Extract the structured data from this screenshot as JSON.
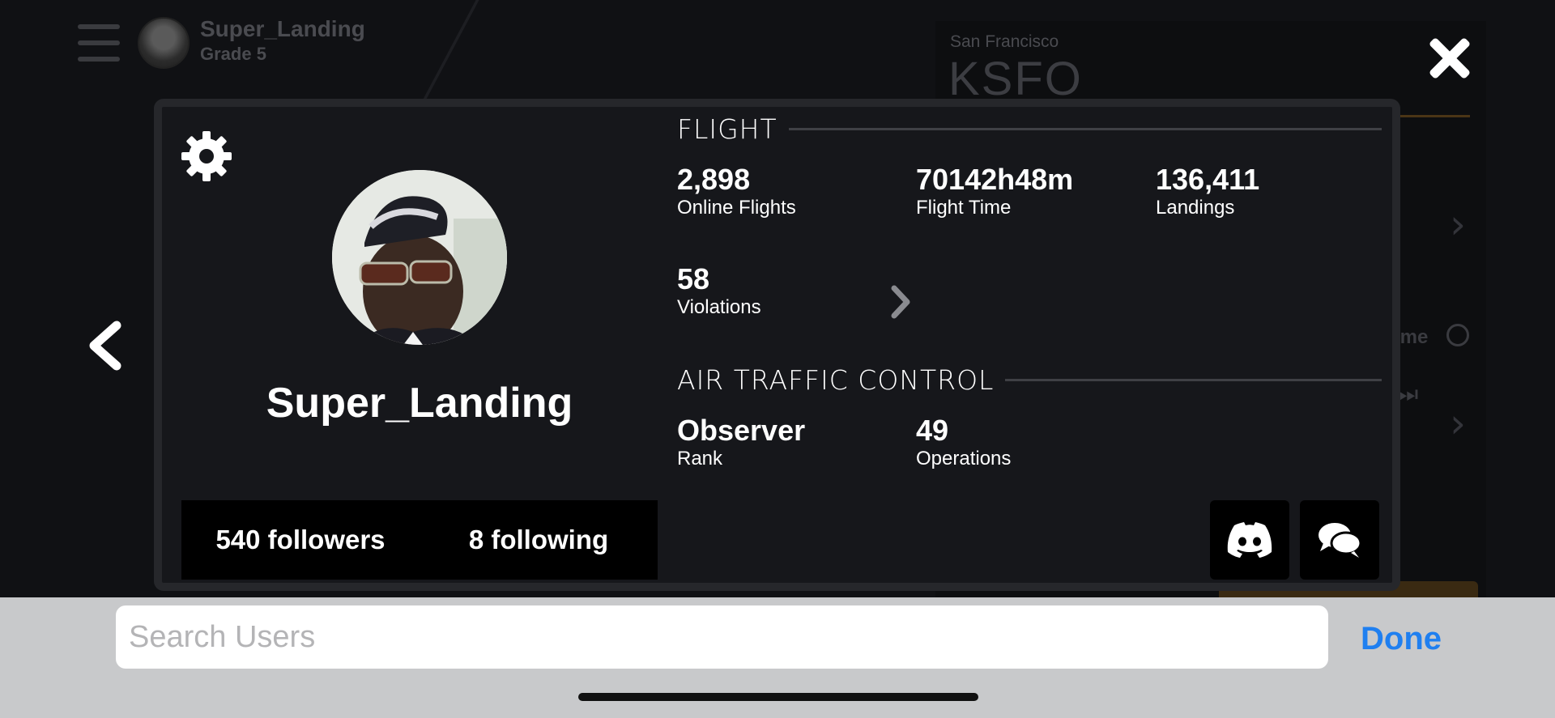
{
  "background": {
    "username": "Super_Landing",
    "grade": "Grade 5",
    "airport_city": "San Francisco",
    "airport_code": "KSFO",
    "time_label_fragment": "ime"
  },
  "profile": {
    "username": "Super_Landing",
    "followers": "540 followers",
    "following": "8 following"
  },
  "flight": {
    "heading": "FLIGHT",
    "stats": [
      {
        "value": "2,898",
        "label": "Online Flights"
      },
      {
        "value": "70142h48m",
        "label": "Flight Time"
      },
      {
        "value": "136,411",
        "label": "Landings"
      },
      {
        "value": "58",
        "label": "Violations"
      }
    ]
  },
  "atc": {
    "heading": "AIR TRAFFIC CONTROL",
    "stats": [
      {
        "value": "Observer",
        "label": "Rank"
      },
      {
        "value": "49",
        "label": "Operations"
      }
    ]
  },
  "search": {
    "placeholder": "Search Users",
    "done_label": "Done"
  },
  "icons": {
    "menu": "hamburger-icon",
    "close": "close-icon",
    "back": "chevron-left-icon",
    "settings": "gear-icon",
    "discord": "discord-icon",
    "chat": "chat-bubbles-icon"
  },
  "colors": {
    "accent_blue": "#1f7ff0",
    "card_bg": "#16171b",
    "card_border": "#26272b"
  }
}
